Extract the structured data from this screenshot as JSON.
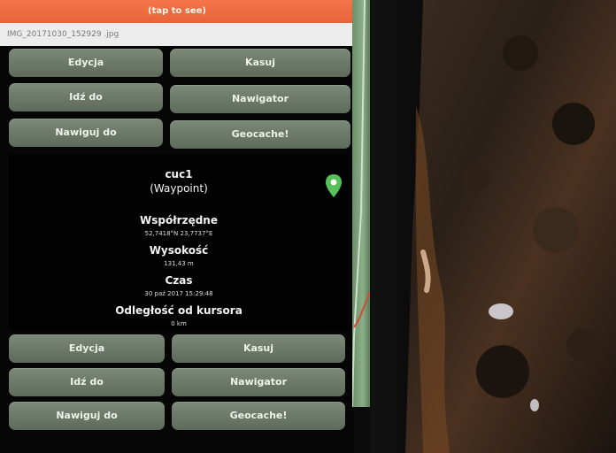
{
  "banner": {
    "tap_to_see": "(tap to see)"
  },
  "file": {
    "name": "IMG_20171030_152929 .jpg"
  },
  "top_buttons": {
    "edit": "Edycja",
    "delete": "Kasuj",
    "go_to": "Idź do",
    "navigator": "Nawigator",
    "navigate_to": "Nawiguj do",
    "geocache": "Geocache!"
  },
  "waypoint": {
    "name": "cuc1",
    "type": "(Waypoint)",
    "coords_label": "Współrzędne",
    "coords_value": "52,7418°N 23,7737°E",
    "altitude_label": "Wysokość",
    "altitude_value": "131,43 m",
    "time_label": "Czas",
    "time_value": "30 paź 2017 15:29:48",
    "distance_label": "Odległość od kursora",
    "distance_value": "0 km"
  },
  "bottom_buttons": {
    "edit": "Edycja",
    "delete": "Kasuj",
    "go_to": "Idź do",
    "navigator": "Nawigator",
    "navigate_to": "Nawiguj do",
    "geocache": "Geocache!"
  },
  "colors": {
    "tap_bar": "#ef6e42",
    "button": "#6c786a",
    "pin": "#58c05a",
    "map_strip": "#8bb088"
  },
  "icons": {
    "location_pin": "location-pin-icon"
  }
}
